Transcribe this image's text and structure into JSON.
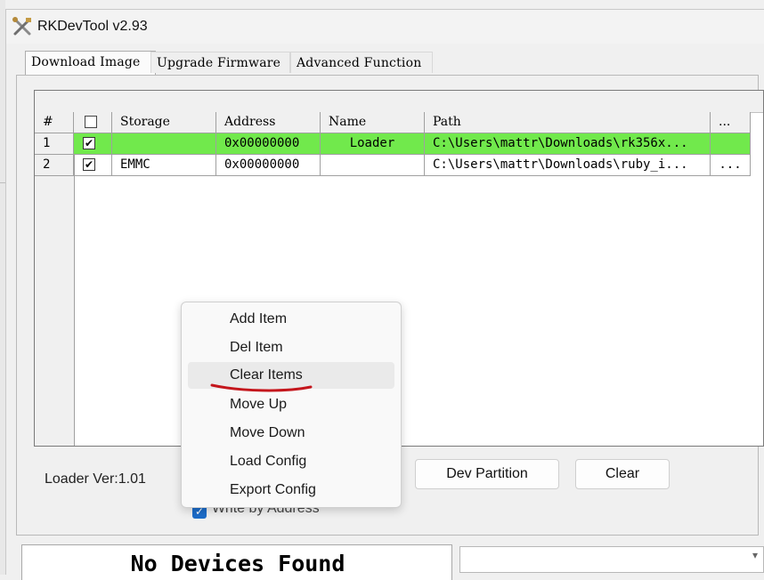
{
  "window": {
    "title": "RKDevTool v2.93"
  },
  "tabs": [
    "Download Image",
    "Upgrade Firmware",
    "Advanced Function"
  ],
  "table": {
    "headers": [
      "#",
      "Storage",
      "Address",
      "Name",
      "Path",
      "..."
    ],
    "rows": [
      {
        "index": "1",
        "checked": true,
        "storage": "",
        "address": "0x00000000",
        "name": "Loader",
        "path": "C:\\Users\\mattr\\Downloads\\rk356x...",
        "browse": "",
        "highlight": true
      },
      {
        "index": "2",
        "checked": true,
        "storage": "EMMC",
        "address": "0x00000000",
        "name": "",
        "path": "C:\\Users\\mattr\\Downloads\\ruby_i...",
        "browse": "...",
        "highlight": false
      }
    ]
  },
  "loader_version": "Loader Ver:1.01",
  "buttons": {
    "dev_partition": "Dev Partition",
    "clear": "Clear"
  },
  "write_by_address": {
    "label": "Write by Address",
    "checked": true
  },
  "status": "No Devices Found",
  "context_menu": {
    "items": [
      "Add Item",
      "Del Item",
      "Clear Items",
      "Move Up",
      "Move Down",
      "Load Config",
      "Export Config"
    ],
    "hovered": "Clear Items"
  },
  "colors": {
    "row_highlight": "#71e94c",
    "annotation_underline": "#c4161c",
    "checkbox_accent": "#1c6cc8"
  },
  "icons": {
    "app": "crossed-tools-icon",
    "checkbox": "check-icon",
    "dropdown": "chevron-down-icon"
  }
}
